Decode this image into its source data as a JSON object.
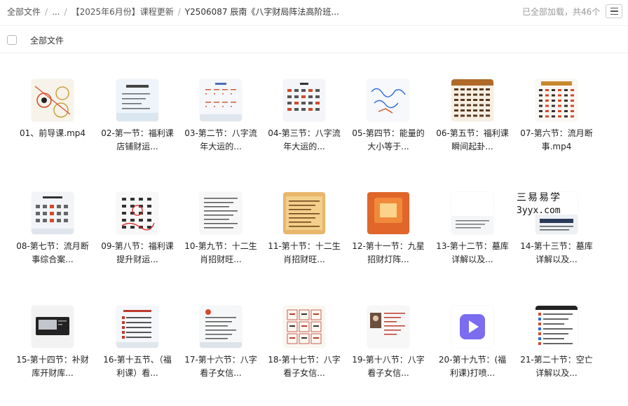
{
  "breadcrumb": {
    "root": "全部文件",
    "ellipsis": "...",
    "folder": "【2025年6月份】课程更新",
    "current": "Y2506087 辰南《八字财局阵法高阶班..."
  },
  "status": {
    "loaded_text": "已全部加载，共46个"
  },
  "header": {
    "all_files_label": "全部文件"
  },
  "watermark": {
    "line1": "三易易学",
    "line2": "3yyx.com"
  },
  "files": [
    {
      "label": "01、前导课.mp4",
      "thumb": "diagram"
    },
    {
      "label": "02-第一节：福利课 店铺财运...",
      "thumb": "slide-list"
    },
    {
      "label": "03-第二节：八字流年大运的...",
      "thumb": "slide-table"
    },
    {
      "label": "04-第三节：八字流年大运的...",
      "thumb": "slide-grid"
    },
    {
      "label": "05-第四节：能量的大小等于...",
      "thumb": "handwriting"
    },
    {
      "label": "06-第五节：福利课 瞬间起卦...",
      "thumb": "table-brown"
    },
    {
      "label": "07-第六节：流月断事.mp4",
      "thumb": "table-red"
    },
    {
      "label": "08-第七节：流月断事综合案...",
      "thumb": "slide-grid2"
    },
    {
      "label": "09-第八节：福利课 提升财运...",
      "thumb": "handwriting-red"
    },
    {
      "label": "10-第九节：十二生肖招财旺...",
      "thumb": "text-doc"
    },
    {
      "label": "11-第十节：十二生肖招财旺...",
      "thumb": "text-orange"
    },
    {
      "label": "12-第十一节：九星招财灯阵...",
      "thumb": "orange"
    },
    {
      "label": "13-第十二节：墓库详解以及...",
      "thumb": "partial"
    },
    {
      "label": "14-第十三节：墓库详解以及...",
      "thumb": "partial2"
    },
    {
      "label": "15-第十四节：补财库开财库...",
      "thumb": "screen"
    },
    {
      "label": "16-第十五节、（福利课）看...",
      "thumb": "slide-red-list"
    },
    {
      "label": "17-第十六节：八字看子女信...",
      "thumb": "slide-text"
    },
    {
      "label": "18-第十七节：八字看子女信...",
      "thumb": "chart-grid"
    },
    {
      "label": "19-第十八节：八字看子女信...",
      "thumb": "photo-text"
    },
    {
      "label": "20-第十九节：(福利课)打喷...",
      "thumb": "video"
    },
    {
      "label": "21-第二十节：空亡详解以及...",
      "thumb": "phone"
    }
  ]
}
